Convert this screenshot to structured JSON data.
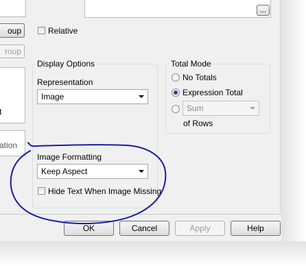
{
  "top": {
    "relative_label": "Relative",
    "cut_button_1": "oup",
    "cut_button_2": "roup",
    "browse_button": "..."
  },
  "left_panel": {
    "cut_text_1": "t",
    "cut_text_2": "ation"
  },
  "display_options": {
    "legend": "Display Options",
    "representation_label": "Representation",
    "representation_value": "Image",
    "image_formatting_label": "Image Formatting",
    "image_formatting_value": "Keep Aspect",
    "hide_text_label": "Hide Text When Image Missing"
  },
  "total_mode": {
    "legend": "Total Mode",
    "no_totals": "No Totals",
    "expression_total": "Expression Total",
    "sum_value": "Sum",
    "of_rows": "of Rows",
    "selected": "Expression Total"
  },
  "buttons": {
    "ok": "OK",
    "cancel": "Cancel",
    "apply": "Apply",
    "help": "Help"
  },
  "annotation": {
    "color": "#1a1aa8"
  }
}
